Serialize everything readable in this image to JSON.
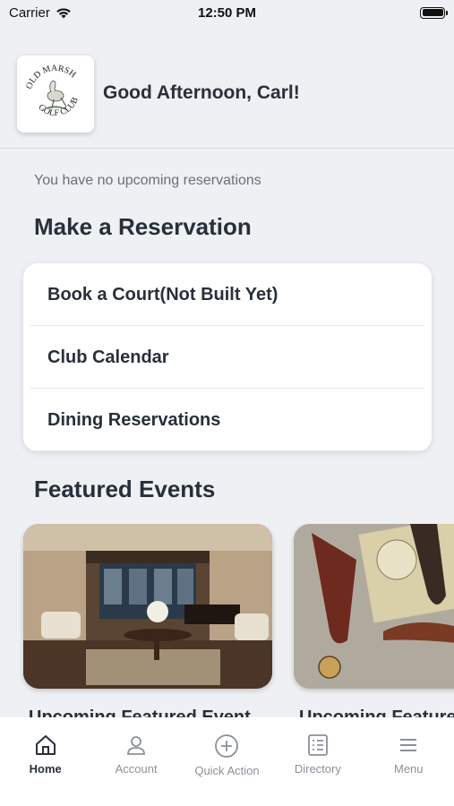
{
  "status": {
    "carrier": "Carrier",
    "time": "12:50 PM"
  },
  "header": {
    "logo_text": "OLD MARSH GOLF CLUB",
    "greeting": "Good Afternoon, Carl!"
  },
  "reservations": {
    "empty_text": "You have no upcoming reservations"
  },
  "make_reservation": {
    "title": "Make a Reservation",
    "items": [
      {
        "label": "Book a Court(Not Built Yet)"
      },
      {
        "label": "Club Calendar"
      },
      {
        "label": "Dining Reservations"
      }
    ]
  },
  "featured": {
    "title": "Featured Events",
    "events": [
      {
        "caption": "Upcoming Featured Event"
      },
      {
        "caption": "Upcoming Featured Event"
      }
    ]
  },
  "tabs": [
    {
      "label": "Home",
      "icon": "home-icon",
      "active": true
    },
    {
      "label": "Account",
      "icon": "account-icon"
    },
    {
      "label": "Quick Action",
      "icon": "plus-circle-icon"
    },
    {
      "label": "Directory",
      "icon": "directory-icon"
    },
    {
      "label": "Menu",
      "icon": "menu-icon"
    }
  ],
  "colors": {
    "background": "#eef0f3",
    "text": "#27303a",
    "muted": "#8b9098"
  }
}
